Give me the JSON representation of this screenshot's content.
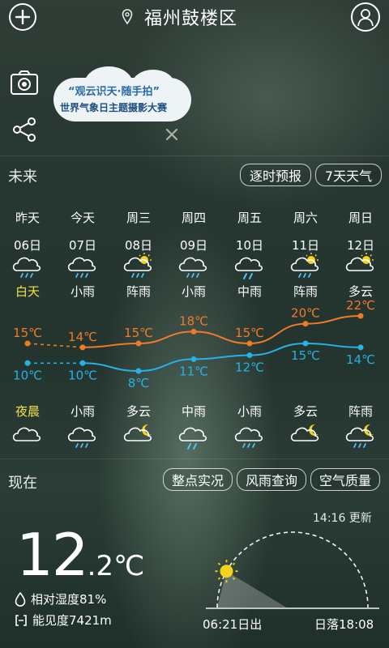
{
  "header": {
    "city": "福州鼓楼区",
    "add_icon": "plus-icon",
    "location_icon": "location-pin-icon",
    "profile_icon": "user-icon"
  },
  "banner": {
    "line1": "“观云识天·随手拍”",
    "line2": "世界气象日主题摄影大赛",
    "camera_icon": "camera-icon",
    "share_icon": "share-icon",
    "close_icon": "close-icon"
  },
  "future": {
    "label": "未来",
    "hourly_button": "逐时预报",
    "week_button": "7天天气"
  },
  "days": [
    {
      "name": "昨天",
      "date": "06日",
      "day_weather": "白天",
      "night_weather": "夜晨",
      "high": "15℃",
      "low": "10℃",
      "day_icon": "cloud-rain-icon",
      "night_icon": "cloud-icon"
    },
    {
      "name": "今天",
      "date": "07日",
      "day_weather": "小雨",
      "night_weather": "小雨",
      "high": "14℃",
      "low": "10℃",
      "day_icon": "cloud-rain-icon",
      "night_icon": "cloud-rain-icon"
    },
    {
      "name": "周三",
      "date": "08日",
      "day_weather": "阵雨",
      "night_weather": "多云",
      "high": "15℃",
      "low": "8℃",
      "day_icon": "sun-cloud-rain-icon",
      "night_icon": "moon-cloud-icon"
    },
    {
      "name": "周四",
      "date": "09日",
      "day_weather": "小雨",
      "night_weather": "中雨",
      "high": "18℃",
      "low": "11℃",
      "day_icon": "cloud-rain-icon",
      "night_icon": "cloud-heavy-rain-icon"
    },
    {
      "name": "周五",
      "date": "10日",
      "day_weather": "中雨",
      "night_weather": "小雨",
      "high": "15℃",
      "low": "12℃",
      "day_icon": "cloud-heavy-rain-icon",
      "night_icon": "cloud-rain-icon"
    },
    {
      "name": "周六",
      "date": "11日",
      "day_weather": "阵雨",
      "night_weather": "多云",
      "high": "20℃",
      "low": "15℃",
      "day_icon": "sun-cloud-rain-icon",
      "night_icon": "moon-cloud-icon"
    },
    {
      "name": "周日",
      "date": "12日",
      "day_weather": "多云",
      "night_weather": "阵雨",
      "high": "22℃",
      "low": "14℃",
      "day_icon": "sun-cloud-icon",
      "night_icon": "moon-cloud-rain-icon"
    }
  ],
  "chart_data": {
    "type": "line",
    "categories": [
      "昨天",
      "今天",
      "周三",
      "周四",
      "周五",
      "周六",
      "周日"
    ],
    "series": [
      {
        "values": [
          15,
          14,
          15,
          18,
          15,
          20,
          22
        ],
        "color": "#f07a28"
      },
      {
        "values": [
          10,
          10,
          8,
          11,
          12,
          15,
          14
        ],
        "color": "#26b2e6"
      }
    ],
    "yesterday_segment_style": "dashed"
  },
  "now": {
    "label": "现在",
    "buttons": [
      "整点实况",
      "风雨查询",
      "空气质量"
    ],
    "updated": "14:16 更新",
    "temp_int": "12",
    "temp_dec": ".2℃",
    "humidity": "相对湿度81%",
    "visibility": "能见度7421m",
    "sunrise": "06:21日出",
    "sunset": "日落18:08",
    "sun_progress": 0.16
  },
  "colors": {
    "high_line": "#f07a28",
    "low_line": "#26b2e6",
    "accent_yellow": "#f2e24a",
    "sun": "#f5d21e"
  }
}
